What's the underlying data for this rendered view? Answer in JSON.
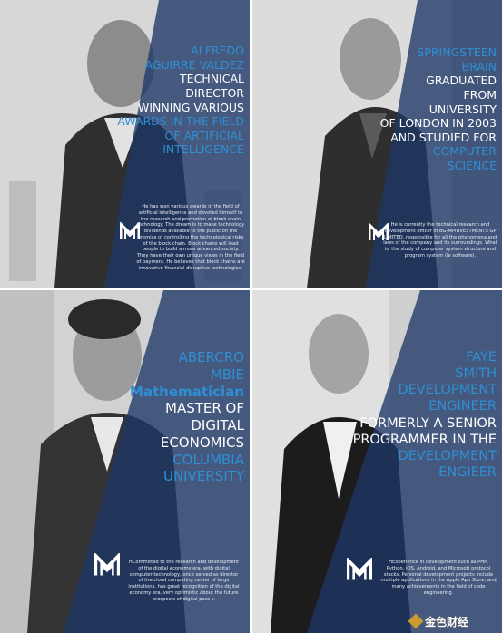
{
  "panels": [
    {
      "name_lines": [
        "AlFREDO",
        "AGUIRRE VALDEZ"
      ],
      "title_lines": [
        "TECHNICAL",
        "DIRECTOR",
        "WINNING VARIOUS"
      ],
      "highlight_lines": [
        "AWARDS IN THE FIELD",
        "OF ARTIFICIAL",
        "INTELLIGENCE"
      ],
      "bio": "He has won various awards in the field of artificial intelligence and devoted himself to the research and promotion of block chain technology. The dream is to make technology dividends available to the public on the premise of controlling the technological risks of the block chain. Block chains will lead people to build a more advanced society. They have their own unique views in the field of payment. He believes that block chains are innovative financial disruptive technologies."
    },
    {
      "name_lines": [
        "SPRINGSTEEN",
        "BRAIN"
      ],
      "title_lines": [
        "GRADUATED",
        "FROM",
        "UNIVERSITY",
        "OF LONDON IN 2003",
        "AND STUDIED FOR"
      ],
      "highlight_lines": [
        "COMPUTER",
        "SCIENCE"
      ],
      "bio": "He is currently the technical research and development officer of BG-MPINVESTMENTS GP LIMITED, responsible for all the phenomena and laws of the company and its surroundings. What is, the study of computer system structure and program system (ie software)."
    },
    {
      "name_lines": [
        "ABERCRO",
        "MBIE"
      ],
      "role_line": "Mathematician",
      "title_lines": [
        "MASTER OF",
        "DIGITAL",
        "ECONOMICS"
      ],
      "highlight_lines": [
        "COLUMBIA",
        "UNIVERSITY"
      ],
      "bio": "HCommitted to the research and development of the digital economy era, with digital computer technology, once served as director of the cloud computing center of large institutions, has great recognition of the digital economy era, very optimistic about the future prospects of digital pass s."
    },
    {
      "name_lines": [
        "FAYE",
        "SMITH"
      ],
      "role_lines": [
        "DEVELOPMENT",
        "ENGINEER"
      ],
      "title_lines": [
        "FORMERLY A SENIOR",
        "PROGRAMMER IN THE"
      ],
      "highlight_lines": [
        "DEVELOPMENT",
        "ENGIEER"
      ],
      "bio": "HExperience in development such as PHP, Python, iOS, Android, and Microsoft protocol stacks. Personal development projects include multiple applications in the Apple App Store, and many achievements in the field of code engineering."
    }
  ],
  "watermark": "金色财经",
  "colors": {
    "accent": "#2e8fd4",
    "overlay": "#1e3766"
  }
}
